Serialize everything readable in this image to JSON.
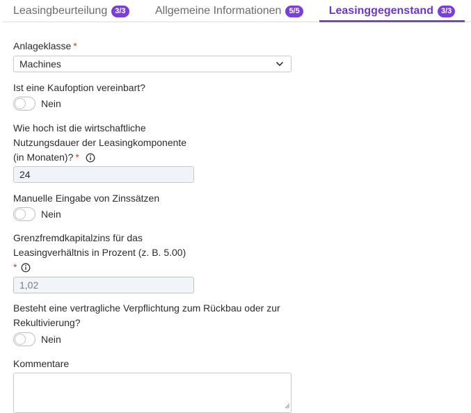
{
  "tabs": [
    {
      "label": "Leasingbeurteilung",
      "badge": "3/3"
    },
    {
      "label": "Allgemeine Informationen",
      "badge": "5/5"
    },
    {
      "label": "Leasinggegenstand",
      "badge": "3/3",
      "active": true
    }
  ],
  "form": {
    "anlageklasse": {
      "label": "Anlageklasse",
      "required": "*",
      "value": "Machines"
    },
    "kaufoption": {
      "label": "Ist eine Kaufoption vereinbart?",
      "toggle_text": "Nein",
      "on": false
    },
    "nutzungsdauer": {
      "label_lines": [
        "Wie hoch ist die wirtschaftliche",
        "Nutzungsdauer der Leasingkomponente",
        "(in Monaten)?"
      ],
      "required": "*",
      "value": "24"
    },
    "zinssaetze": {
      "label": "Manuelle Eingabe von Zinssätzen",
      "toggle_text": "Nein",
      "on": false
    },
    "grenzfremdkapitalzins": {
      "label_lines": [
        "Grenzfremdkapitalzins für das",
        "Leasingverhältnis in Prozent (z. B. 5.00)"
      ],
      "required": "*",
      "value": "1,02"
    },
    "rueckbau": {
      "label_lines": [
        "Besteht eine vertragliche Verpflichtung zum Rückbau oder zur",
        "Rekultivierung?"
      ],
      "toggle_text": "Nein",
      "on": false
    },
    "kommentare": {
      "label": "Kommentare",
      "value": ""
    }
  },
  "colors": {
    "accent": "#7a3fd6",
    "required": "#d9381e"
  },
  "icons": {
    "info": "info-icon",
    "dropdown": "chevron-down-icon"
  }
}
